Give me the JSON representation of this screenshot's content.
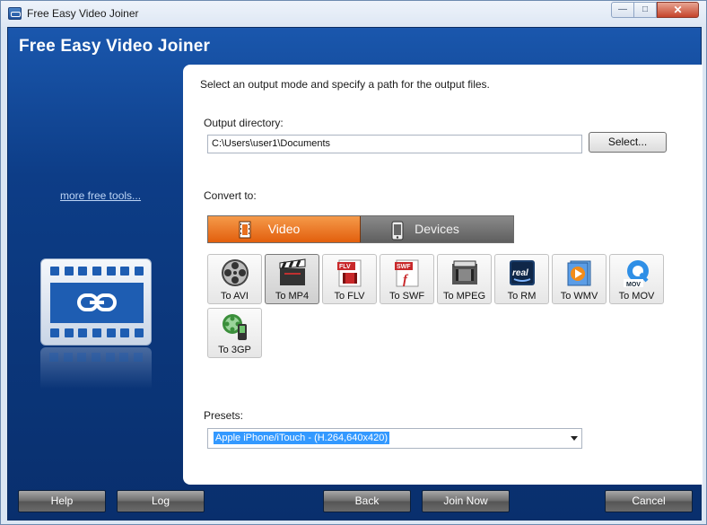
{
  "window": {
    "title": "Free Easy Video Joiner",
    "min_label": "—",
    "max_label": "□",
    "close_label": "✕"
  },
  "app": {
    "heading": "Free Easy Video Joiner",
    "more_tools": "more free tools..."
  },
  "panel": {
    "instruction": "Select an output mode and specify a path for the output files.",
    "output_dir_label": "Output directory:",
    "output_dir_value": "C:\\Users\\user1\\Documents",
    "select_button": "Select...",
    "convert_label": "Convert to:",
    "tabs": [
      {
        "label": "Video",
        "active": true
      },
      {
        "label": "Devices",
        "active": false
      }
    ],
    "formats": [
      {
        "label": "To AVI",
        "icon": "film-reel-icon"
      },
      {
        "label": "To MP4",
        "icon": "clapperboard-icon",
        "selected": true
      },
      {
        "label": "To FLV",
        "icon": "flv-file-icon"
      },
      {
        "label": "To SWF",
        "icon": "swf-flash-icon"
      },
      {
        "label": "To MPEG",
        "icon": "mpeg-film-icon"
      },
      {
        "label": "To RM",
        "icon": "real-media-icon"
      },
      {
        "label": "To WMV",
        "icon": "wmv-play-icon"
      },
      {
        "label": "To MOV",
        "icon": "quicktime-icon"
      },
      {
        "label": "To 3GP",
        "icon": "mobile-3gp-icon"
      }
    ],
    "presets_label": "Presets:",
    "preset_value": "Apple iPhone/iTouch - (H.264,640x420)"
  },
  "buttons": {
    "help": "Help",
    "log": "Log",
    "back": "Back",
    "join_now": "Join Now",
    "cancel": "Cancel"
  },
  "colors": {
    "frame_blue": "#0d3d87",
    "tab_active": "#e8701f",
    "tab_inactive": "#707070"
  }
}
